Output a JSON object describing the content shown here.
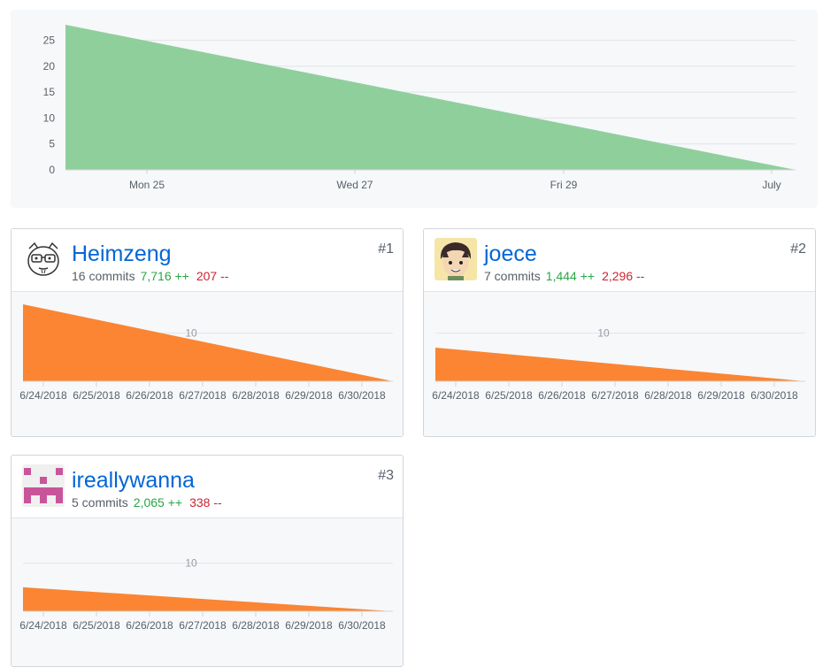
{
  "colors": {
    "main_area": "#8fcf9c",
    "user_area": "#fb8532",
    "link": "#0366d6",
    "additions": "#28a745",
    "deletions": "#cb2431"
  },
  "chart_data": [
    {
      "type": "area",
      "x": [
        "Mon 25",
        "Wed 27",
        "Fri 29",
        "July"
      ],
      "y_ticks": [
        0,
        5,
        10,
        15,
        20,
        25
      ],
      "ylim": [
        0,
        28
      ],
      "series": [
        {
          "points": [
            {
              "x": "2018-06-24",
              "y": 28
            },
            {
              "x": "2018-07-01",
              "y": 0
            }
          ]
        }
      ],
      "grid": true
    },
    {
      "type": "area",
      "x": [
        "6/24/2018",
        "6/25/2018",
        "6/26/2018",
        "6/27/2018",
        "6/28/2018",
        "6/29/2018",
        "6/30/2018"
      ],
      "y_ticks": [
        10
      ],
      "ylim": [
        0,
        16
      ],
      "series": [
        {
          "points": [
            {
              "x": "2018-06-24",
              "y": 16
            },
            {
              "x": "2018-07-01",
              "y": 0
            }
          ]
        }
      ]
    },
    {
      "type": "area",
      "x": [
        "6/24/2018",
        "6/25/2018",
        "6/26/2018",
        "6/27/2018",
        "6/28/2018",
        "6/29/2018",
        "6/30/2018"
      ],
      "y_ticks": [
        10
      ],
      "ylim": [
        0,
        16
      ],
      "series": [
        {
          "points": [
            {
              "x": "2018-06-24",
              "y": 7
            },
            {
              "x": "2018-07-01",
              "y": 0
            }
          ]
        }
      ]
    },
    {
      "type": "area",
      "x": [
        "6/24/2018",
        "6/25/2018",
        "6/26/2018",
        "6/27/2018",
        "6/28/2018",
        "6/29/2018",
        "6/30/2018"
      ],
      "y_ticks": [
        10
      ],
      "ylim": [
        0,
        16
      ],
      "series": [
        {
          "points": [
            {
              "x": "2018-06-24",
              "y": 5
            },
            {
              "x": "2018-07-01",
              "y": 0
            }
          ]
        }
      ]
    }
  ],
  "contributors": [
    {
      "rank": "#1",
      "name": "Heimzeng",
      "commits": "16 commits",
      "additions": "7,716 ++",
      "deletions": "207 --",
      "avatar": "cartoon-face-glasses"
    },
    {
      "rank": "#2",
      "name": "joece",
      "commits": "7 commits",
      "additions": "1,444 ++",
      "deletions": "2,296 --",
      "avatar": "cartoon-boy"
    },
    {
      "rank": "#3",
      "name": "ireallywanna",
      "commits": "5 commits",
      "additions": "2,065 ++",
      "deletions": "338 --",
      "avatar": "identicon"
    }
  ]
}
